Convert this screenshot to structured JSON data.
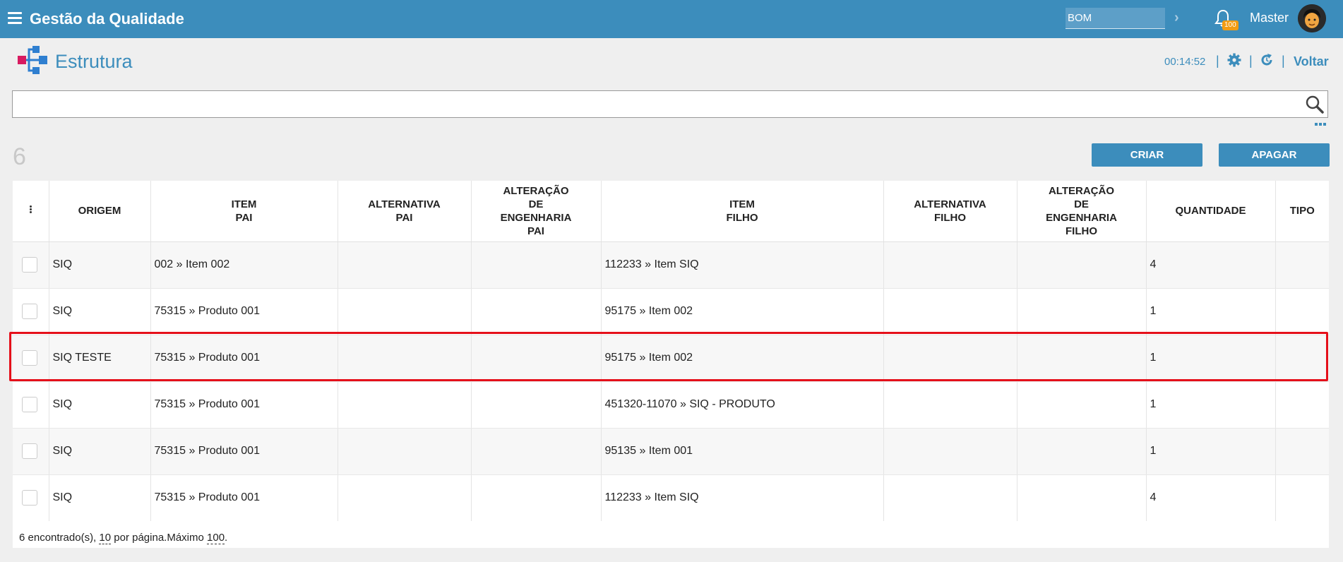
{
  "topbar": {
    "app_title": "Gestão da Qualidade",
    "module_value": "BOM",
    "notifications_count": "100",
    "user_name": "Master",
    "colors": {
      "bar": "#3c8dbc",
      "badge": "#f39c12"
    }
  },
  "header": {
    "title": "Estrutura",
    "clock": "00:14:52",
    "separator": "|",
    "back_label": "Voltar"
  },
  "search": {
    "value": "",
    "placeholder": ""
  },
  "toolbar": {
    "record_count": "6",
    "create_label": "CRIAR",
    "delete_label": "APAGAR"
  },
  "table": {
    "columns": [
      {
        "key": "menu",
        "label": ""
      },
      {
        "key": "origem",
        "label": "ORIGEM"
      },
      {
        "key": "item_pai",
        "label": "ITEM\nPAI"
      },
      {
        "key": "alt_pai",
        "label": "ALTERNATIVA\nPAI"
      },
      {
        "key": "alt_eng_pai",
        "label": "ALTERAÇÃO\nDE\nENGENHARIA\nPAI"
      },
      {
        "key": "item_filho",
        "label": "ITEM\nFILHO"
      },
      {
        "key": "alt_filho",
        "label": "ALTERNATIVA\nFILHO"
      },
      {
        "key": "alt_eng_filho",
        "label": "ALTERAÇÃO\nDE\nENGENHARIA\nFILHO"
      },
      {
        "key": "quantidade",
        "label": "QUANTIDADE"
      },
      {
        "key": "tipo",
        "label": "TIPO"
      }
    ],
    "rows": [
      {
        "origem": "SIQ",
        "item_pai": "002 » Item 002",
        "alt_pai": "",
        "alt_eng_pai": "",
        "item_filho": "112233 » Item SIQ",
        "alt_filho": "",
        "alt_eng_filho": "",
        "quantidade": "4",
        "tipo": ""
      },
      {
        "origem": "SIQ",
        "item_pai": "75315 » Produto 001",
        "alt_pai": "",
        "alt_eng_pai": "",
        "item_filho": "95175 » Item 002",
        "alt_filho": "",
        "alt_eng_filho": "",
        "quantidade": "1",
        "tipo": ""
      },
      {
        "origem": "SIQ TESTE",
        "item_pai": "75315 » Produto 001",
        "alt_pai": "",
        "alt_eng_pai": "",
        "item_filho": "95175 » Item 002",
        "alt_filho": "",
        "alt_eng_filho": "",
        "quantidade": "1",
        "tipo": ""
      },
      {
        "origem": "SIQ",
        "item_pai": "75315 » Produto 001",
        "alt_pai": "",
        "alt_eng_pai": "",
        "item_filho": "451320-11070 » SIQ - PRODUTO",
        "alt_filho": "",
        "alt_eng_filho": "",
        "quantidade": "1",
        "tipo": ""
      },
      {
        "origem": "SIQ",
        "item_pai": "75315 » Produto 001",
        "alt_pai": "",
        "alt_eng_pai": "",
        "item_filho": "95135 » Item 001",
        "alt_filho": "",
        "alt_eng_filho": "",
        "quantidade": "1",
        "tipo": ""
      },
      {
        "origem": "SIQ",
        "item_pai": "75315 » Produto 001",
        "alt_pai": "",
        "alt_eng_pai": "",
        "item_filho": "112233 » Item SIQ",
        "alt_filho": "",
        "alt_eng_filho": "",
        "quantidade": "4",
        "tipo": ""
      }
    ],
    "highlighted_row": 2,
    "highlight_color": "#e5101a"
  },
  "footer": {
    "found_text": "6 encontrado(s),",
    "per_page": "10",
    "per_page_text": "por página.Máximo",
    "max": "100",
    "end": "."
  }
}
